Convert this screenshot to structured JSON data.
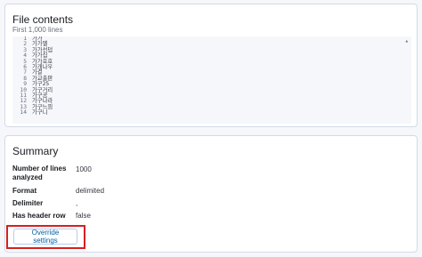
{
  "file_contents": {
    "title": "File contents",
    "subtitle": "First 1,000 lines",
    "lines": [
      {
        "num": "1",
        "text": "가가"
      },
      {
        "num": "2",
        "text": "가가멜"
      },
      {
        "num": "3",
        "text": "가가선덥"
      },
      {
        "num": "4",
        "text": "가가십"
      },
      {
        "num": "5",
        "text": "가가호호"
      },
      {
        "num": "6",
        "text": "가개나우"
      },
      {
        "num": "7",
        "text": "가결"
      },
      {
        "num": "8",
        "text": "가교출판"
      },
      {
        "num": "9",
        "text": "가구25"
      },
      {
        "num": "10",
        "text": "가구거리"
      },
      {
        "num": "11",
        "text": "가구공"
      },
      {
        "num": "12",
        "text": "가구나라"
      },
      {
        "num": "13",
        "text": "가구느낌"
      },
      {
        "num": "14",
        "text": "가구니"
      }
    ]
  },
  "summary": {
    "title": "Summary",
    "items": [
      {
        "term": "Number of lines analyzed",
        "value": "1000"
      },
      {
        "term": "Format",
        "value": "delimited"
      },
      {
        "term": "Delimiter",
        "value": ","
      },
      {
        "term": "Has header row",
        "value": "false"
      }
    ],
    "override_label": "Override settings"
  }
}
